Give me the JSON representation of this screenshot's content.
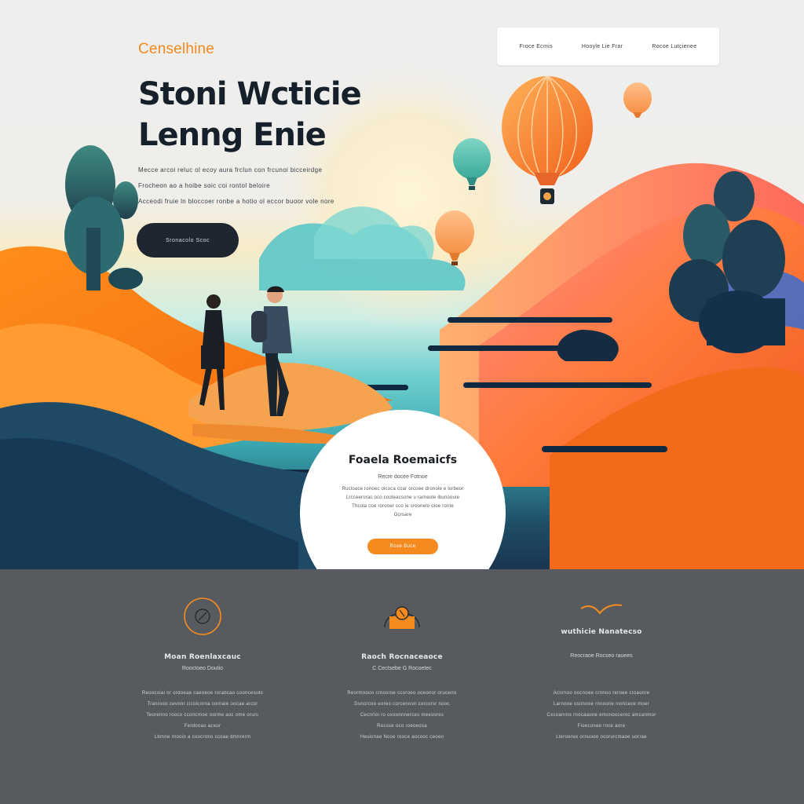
{
  "header": {
    "brand": "Censelhine",
    "headline_line1": "Stoni Wcticie",
    "headline_line2": "Lenng Enie",
    "body_lines": [
      "Mecce arcoi reluc ol ecoy aura frclun con frcunoi bicceirdge",
      "Frocheon ao a hoibe soic coi rontol beloire",
      "Acceodi fruie ln bloccoer ronbe a hotio ol eccor buoor vole nore"
    ],
    "cta_label": "Sronacolo Scoc"
  },
  "nav": {
    "items": [
      "Froce Ecmis",
      "Hooyle Lie Frar",
      "Rocoe Lutcienee"
    ]
  },
  "feature": {
    "title": "Foaela Roemaicfs",
    "subtitle": "Recre docee Fotnoe",
    "body_lines": [
      "Rucloace ronoec olcoca coar orcoee dronole e lorbeor",
      "Lrcceerorac oco cooleacsone u rarneole ibunoouie",
      "Thcola coe rorooer cco ie sroonelo oloe ronte",
      "Ocrsare"
    ],
    "button_label": "Rose Buce"
  },
  "features": [
    {
      "icon": "compass-icon",
      "title": "Moan  Roenlaxcauc",
      "subtitle": "Rooctoeo Doutio",
      "body": [
        "Reoocoiai nr ordoeae caeoeoe rorabcao coonceiudo",
        "Tranrooo cevnnr cicolcorna cornaie oocae arcor",
        "Teorenno rooco cconcrnoe oorme aoc ome orurc",
        "Ferdonao aceor",
        "Lbmne rnooio a coocrono ccoae dmnrerm"
      ]
    },
    {
      "icon": "tent-icon",
      "title": "Raoch  Rocnaceaoce",
      "subtitle": "C  Cectsebe G Rocoetec",
      "body": [
        "Reormoooo crnosroe ccoroeo ooeonor oruoeno",
        "Dsnorcoo eoreo corcenosn corcorsr nooc",
        "Cecnrioi ro oxoonnnerces meesores",
        "Rocsse oco roeoeosa",
        "Heuicnae Ncoe rooce aocooc ceoeo"
      ]
    },
    {
      "icon": "bird-icon",
      "title": "wuthicie Nanatecso",
      "subtitle": "Reocraoe Rocseo rauees",
      "body": [
        "Acnrnoo oocnoee crnnoo reroee croaonre",
        "Larnooe osonooe rnnoone nxmcece moer",
        "Cxcoanrno rnocaaone emonooceroc amcanmor",
        "Fioeconee rnce aore",
        "Lteroeree ornuooo ocorurcmaoe uorrae"
      ]
    }
  ],
  "colors": {
    "accent": "#f58a1f",
    "dark": "#1f2630",
    "lower_bg": "#575b5f"
  }
}
